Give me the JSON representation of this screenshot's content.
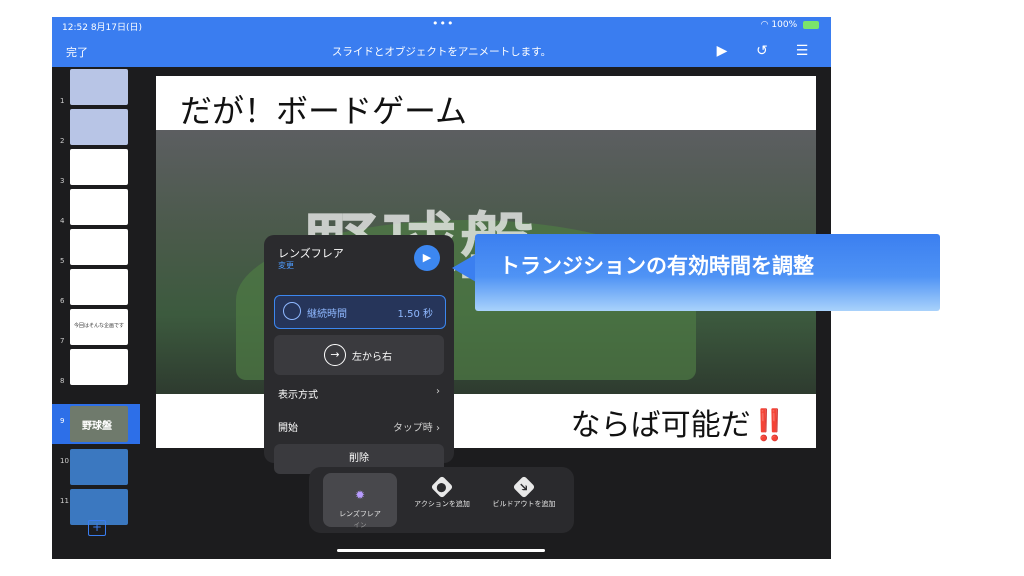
{
  "status": {
    "time": "12:52",
    "date": "8月17日(日)",
    "battery": "100%"
  },
  "nav": {
    "done": "完了",
    "title": "スライドとオブジェクトをアニメートします。"
  },
  "thumbs": {
    "numbers": [
      "1",
      "2",
      "3",
      "4",
      "5",
      "6",
      "7",
      "8",
      "9",
      "10",
      "11"
    ],
    "t7_text": "今回はそんな企画です",
    "t9_text": "野球盤"
  },
  "slide": {
    "title": "だが！ボードゲーム",
    "bigtext": "野球盤",
    "caption": "ならば可能だ",
    "caption_mark": "‼️"
  },
  "popover": {
    "title": "レンズフレア",
    "subtitle": "変更",
    "duration_label": "継続時間",
    "duration_value": "1.50 秒",
    "direction": "左から右",
    "display_label": "表示方式",
    "start_label": "開始",
    "start_value": "タップ時",
    "delete": "削除"
  },
  "callout": {
    "text": "トランジションの有効時間を調整"
  },
  "toolbar": {
    "item1": {
      "label": "レンズフレア",
      "sub": "イン"
    },
    "item2": {
      "label": "アクションを追加"
    },
    "item3": {
      "label": "ビルドアウトを追加"
    }
  },
  "colors": {
    "accent": "#3a7df0",
    "callout": "#3b7ff0",
    "exclaim": "#e0241b"
  }
}
